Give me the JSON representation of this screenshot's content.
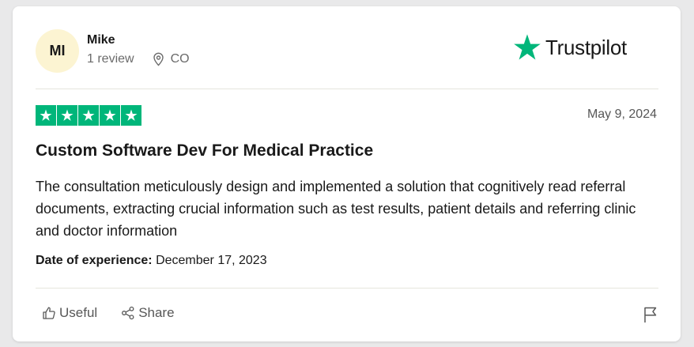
{
  "reviewer": {
    "initials": "MI",
    "name": "Mike",
    "review_count": "1 review",
    "location": "CO",
    "avatar_color": "#fcf4d2"
  },
  "brand": {
    "name": "Trustpilot",
    "star_color": "#00b67a"
  },
  "review": {
    "rating": 5,
    "max_rating": 5,
    "date": "May 9, 2024",
    "title": "Custom Software Dev For Medical Practice",
    "body": "The consultation meticulously design and implemented a solution that cognitively read referral documents, extracting crucial information such as test results, patient details and referring clinic and doctor information",
    "experience_label": "Date of experience:",
    "experience_date": "December 17, 2023"
  },
  "actions": {
    "useful_label": "Useful",
    "share_label": "Share"
  },
  "icons": {
    "location": "location-pin-icon",
    "useful": "thumbs-up-icon",
    "share": "share-icon",
    "flag": "flag-icon",
    "rating_star": "star-icon"
  }
}
